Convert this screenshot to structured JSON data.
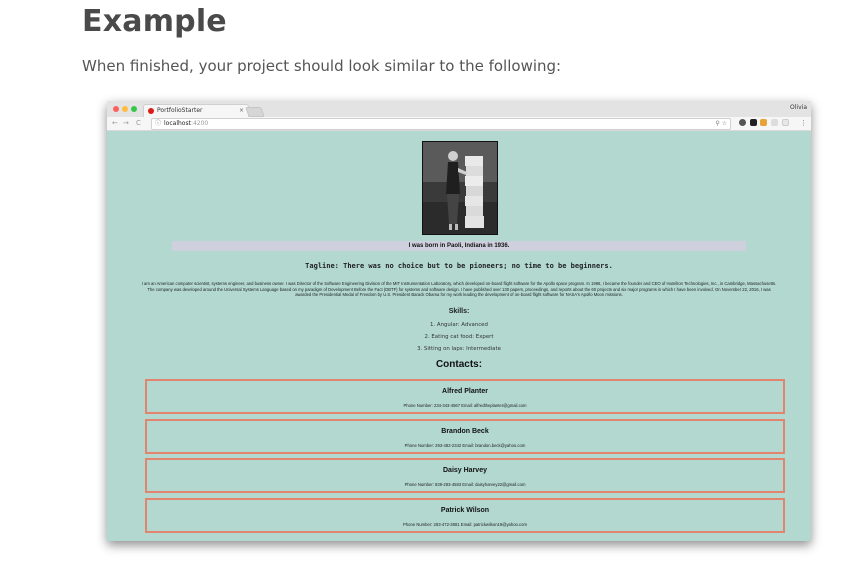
{
  "doc": {
    "heading": "Example",
    "intro": "When finished, your project should look similar to the following:"
  },
  "browser": {
    "tab_title": "PortfolioStarter",
    "tab_close": "×",
    "profile_name": "Olivia",
    "nav": {
      "back": "←",
      "forward": "→",
      "reload": "C"
    },
    "url_host": "localhost",
    "url_port": ":4200",
    "url_info_icon": "ⓘ",
    "toolbar_icons": "⚲ ☆",
    "menu_icon": "⋮",
    "colors": {
      "traffic_red": "#fc605c",
      "traffic_yellow": "#fdbc40",
      "traffic_green": "#34c84a",
      "page_background": "#b2d8d0",
      "caption_background": "#cfd0de",
      "card_border": "#e3846e"
    }
  },
  "page": {
    "caption": "I was born in Paoli, Indiana in 1936.",
    "tagline": "Tagline: There was no choice but to be pioneers; no time to be beginners.",
    "bio": "I am an American computer scientist, systems engineer, and business owner. I was Director of the Software Engineering Division of the MIT Instrumentation Laboratory, which developed on-board flight software for the Apollo space program. In 1986, I became the founder and CEO of Hamilton Technologies, Inc., in Cambridge, Massachusetts. The company was developed around the Universal Systems Language based on my paradigm of Development Before the Fact (DBTF) for systems and software design. I have published over 130 papers, proceedings, and reports about the 60 projects and six major programs in which I have been involved. On November 22, 2016, I was awarded the Presidential Medal of Freedom by U.S. President Barack Obama for my work leading the development of on-board flight software for NASA's Apollo Moon missions.",
    "skills_title": "Skills:",
    "skills": [
      "1. Angular: Advanced",
      "2. Eating cat food: Expert",
      "3. Sitting on laps: Intermediate"
    ],
    "contacts_title": "Contacts:",
    "contacts": [
      {
        "name": "Alfred Planter",
        "info": "Phone Number: 234-343-4567 Email: alfredtheplanter@gmail.com"
      },
      {
        "name": "Brandon Beck",
        "info": "Phone Number: 293-482-2342 Email: brandon.beck@yahoo.com"
      },
      {
        "name": "Daisy Harvey",
        "info": "Phone Number: 839-283-4583 Email: daisyharvey22@gmail.com"
      },
      {
        "name": "Patrick Wilson",
        "info": "Phone Number: 283-472-3881 Email: patrickwilson19@yahoo.com"
      }
    ]
  }
}
